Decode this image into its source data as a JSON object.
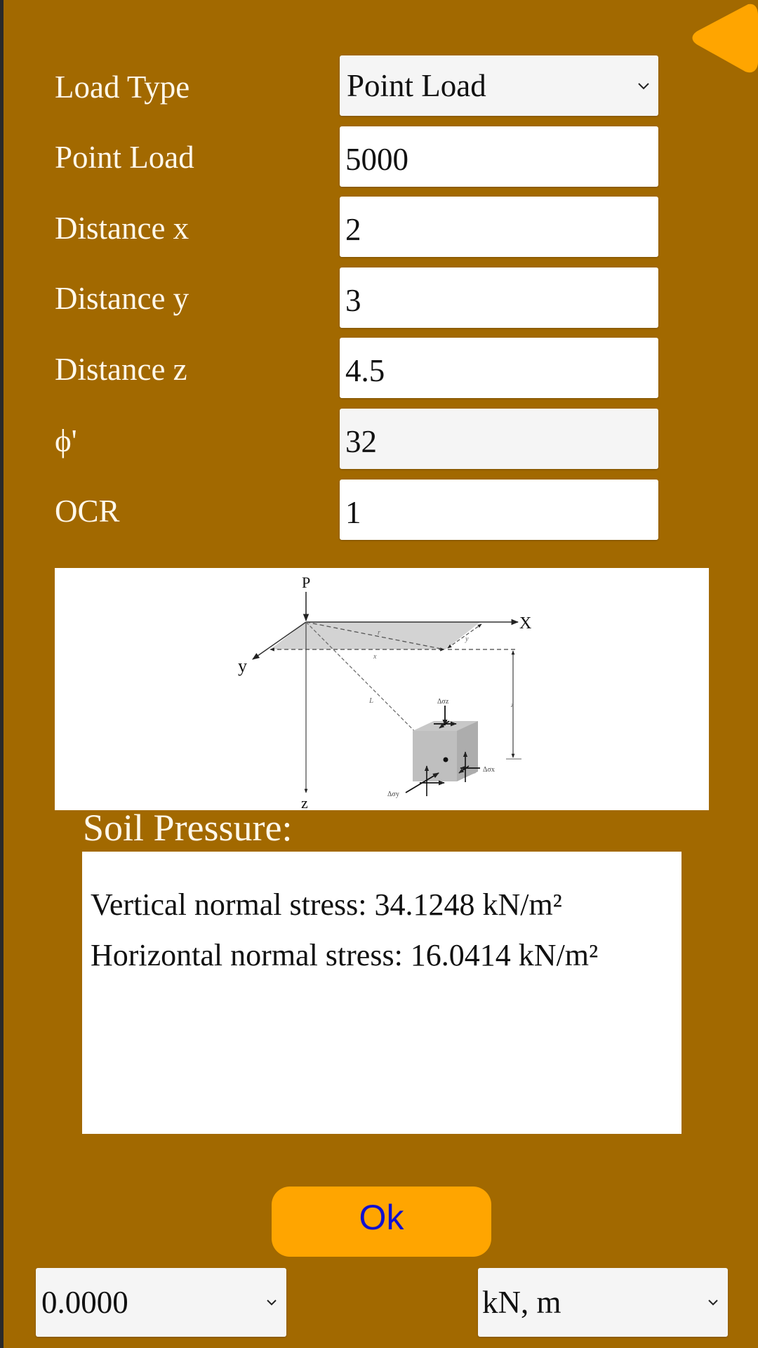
{
  "nav": {
    "back_icon": "back-triangle-icon"
  },
  "form": {
    "load_type": {
      "label": "Load Type",
      "value": "Point Load"
    },
    "point_load": {
      "label": "Point Load",
      "value": "5000"
    },
    "distance_x": {
      "label": "Distance x",
      "value": "2"
    },
    "distance_y": {
      "label": "Distance y",
      "value": "3"
    },
    "distance_z": {
      "label": "Distance z",
      "value": "4.5"
    },
    "phi": {
      "label": "ϕ'",
      "value": "32"
    },
    "ocr": {
      "label": "OCR",
      "value": "1"
    }
  },
  "diagram": {
    "labels": {
      "P": "P",
      "X": "X",
      "Y": "y",
      "Z": "z",
      "r": "r",
      "x": "x",
      "y": "y",
      "L": "L",
      "z": "z",
      "sigma_z": "Δσz",
      "sigma_x": "Δσx",
      "sigma_y": "Δσy"
    }
  },
  "results": {
    "title": "Soil Pressure:",
    "vertical": "Vertical normal stress: 34.1248 kN/m²",
    "horizontal": "Horizontal normal stress: 16.0414 kN/m²"
  },
  "actions": {
    "ok_label": "Ok"
  },
  "footer": {
    "precision_value": "0.0000",
    "units_value": "kN, m"
  },
  "colors": {
    "background": "#a26900",
    "accent": "#ffa500",
    "ok_text": "#1010d0",
    "label_text": "#fff8ea"
  }
}
